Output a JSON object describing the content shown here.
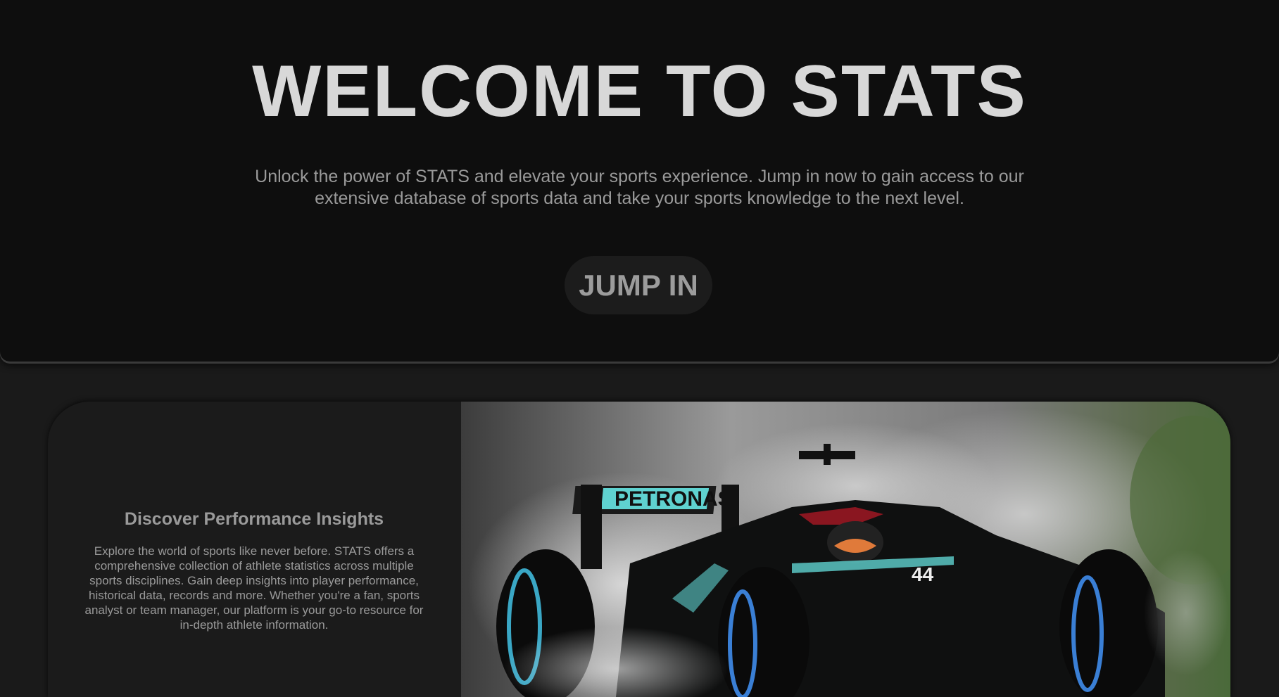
{
  "hero": {
    "title": "WELCOME TO STATS",
    "subtitle": "Unlock the power of STATS and elevate your sports experience. Jump in now to gain access to our extensive database of sports data and take your sports knowledge to the next level.",
    "cta_label": "JUMP IN"
  },
  "feature": {
    "title": "Discover Performance Insights",
    "body": "Explore the world of sports like never before. STATS offers a comprehensive collection of athlete statistics across multiple sports disciplines. Gain deep insights into player performance, historical data, records and more. Whether you're a fan, sports analyst or team manager, our platform is your go-to resource for in-depth athlete information.",
    "image": {
      "livery_text": "PETRONAS",
      "car_number": "44"
    }
  },
  "colors": {
    "hero_bg": "#0e0e0e",
    "page_bg": "#1a1a1a",
    "title_text": "#d8d8d8",
    "muted_text": "#9a9a9a",
    "car_teal": "#5fd2d0"
  }
}
